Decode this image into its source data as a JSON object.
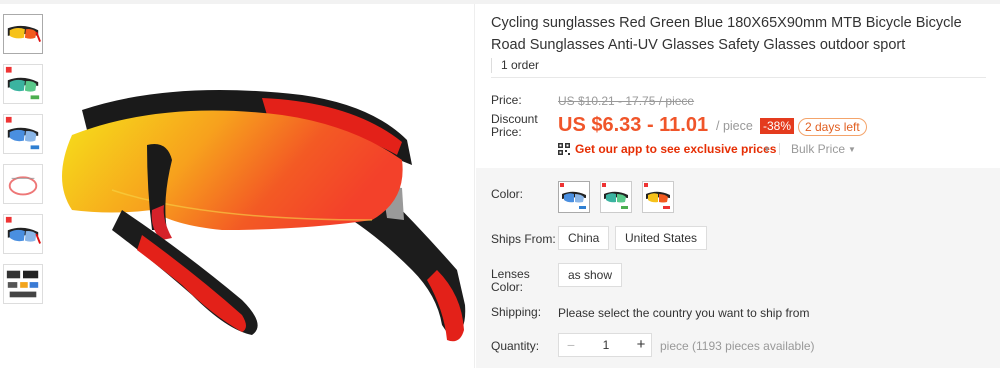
{
  "product": {
    "title": "Cycling sunglasses Red Green Blue 180X65X90mm MTB Bicycle Bicycle Road Sunglasses Anti-UV Glasses Safety Glasses outdoor sport",
    "orders": "1 order"
  },
  "gallery": {
    "thumbnails": [
      "thumb-red-lens",
      "thumb-green-lens",
      "thumb-blue-lens",
      "thumb-glasses-case",
      "thumb-blue-lens-2",
      "thumb-kit"
    ]
  },
  "pricing": {
    "price_label": "Price:",
    "original_price": "US $10.21 - 17.75 / piece",
    "discount_label_line1": "Discount",
    "discount_label_line2": "Price:",
    "current_price": "US $6.33 - 11.01",
    "per_unit": "/ piece",
    "discount_badge": "-38%",
    "days_left": "2 days left",
    "app_promo": "Get our app to see exclusive prices",
    "bulk_price": "Bulk Price"
  },
  "options": {
    "color_label": "Color:",
    "colors": [
      "blue",
      "green",
      "red"
    ],
    "ships_from_label": "Ships From:",
    "ships_from": [
      "China",
      "United States"
    ],
    "lenses_label_line1": "Lenses",
    "lenses_label_line2": "Color:",
    "lenses_value": "as show",
    "shipping_label": "Shipping:",
    "shipping_text": "Please select the country you want to ship from",
    "quantity_label": "Quantity:",
    "quantity_minus": "−",
    "quantity_value": "1",
    "quantity_plus": "+",
    "availability": "piece (1193 pieces available)"
  },
  "colors": {
    "accent": "#f0552a",
    "badge": "#e43b1e",
    "app_promo": "#e62e04"
  }
}
